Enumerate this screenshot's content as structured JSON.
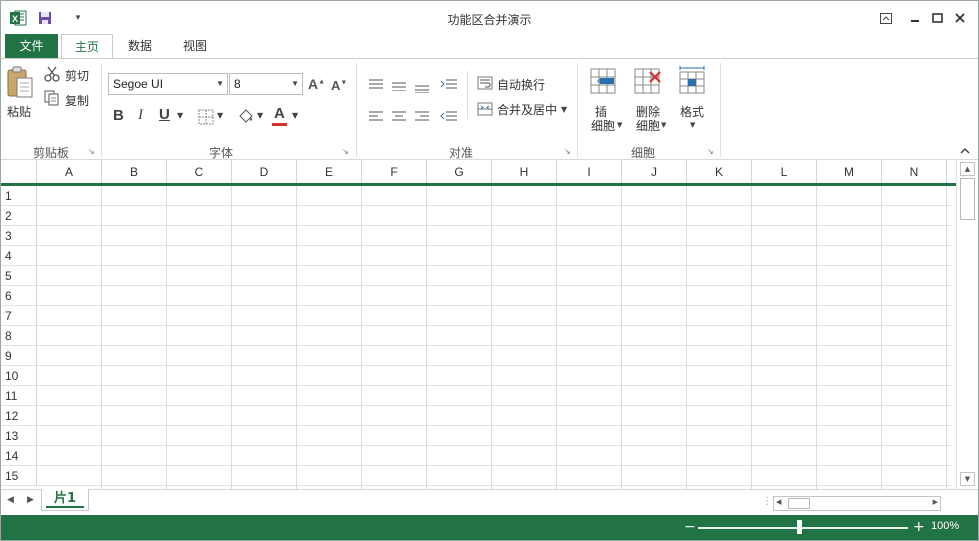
{
  "window": {
    "title": "功能区合并演示"
  },
  "tabs": {
    "file": "文件",
    "home": "主页",
    "data": "数据",
    "view": "视图"
  },
  "clipboard": {
    "paste": "粘贴",
    "cut": "剪切",
    "copy": "复制",
    "group_label": "剪贴板"
  },
  "font": {
    "name": "Segoe UI",
    "size": "8",
    "bold": "B",
    "italic": "I",
    "underline": "U",
    "font_color": "A",
    "grow": "A",
    "shrink": "A",
    "group_label": "字体"
  },
  "alignment": {
    "wrap_text": "自动换行",
    "merge_center": "合并及居中",
    "group_label": "对准"
  },
  "cells": {
    "insert_line1": "插",
    "insert_line2": "细胞",
    "delete_line1": "删除",
    "delete_line2": "细胞",
    "format": "格式",
    "group_label": "细胞"
  },
  "grid": {
    "columns": [
      "A",
      "B",
      "C",
      "D",
      "E",
      "F",
      "G",
      "H",
      "I",
      "J",
      "K",
      "L",
      "M",
      "N"
    ],
    "rows": [
      "1",
      "2",
      "3",
      "4",
      "5",
      "6",
      "7",
      "8",
      "9",
      "10",
      "11",
      "12",
      "13",
      "14",
      "15"
    ]
  },
  "sheets": {
    "active": "片1"
  },
  "status": {
    "zoom": "100%",
    "zoom_percent": 48
  },
  "colors": {
    "accent": "#217346",
    "font_color_bar": "#d03030"
  }
}
